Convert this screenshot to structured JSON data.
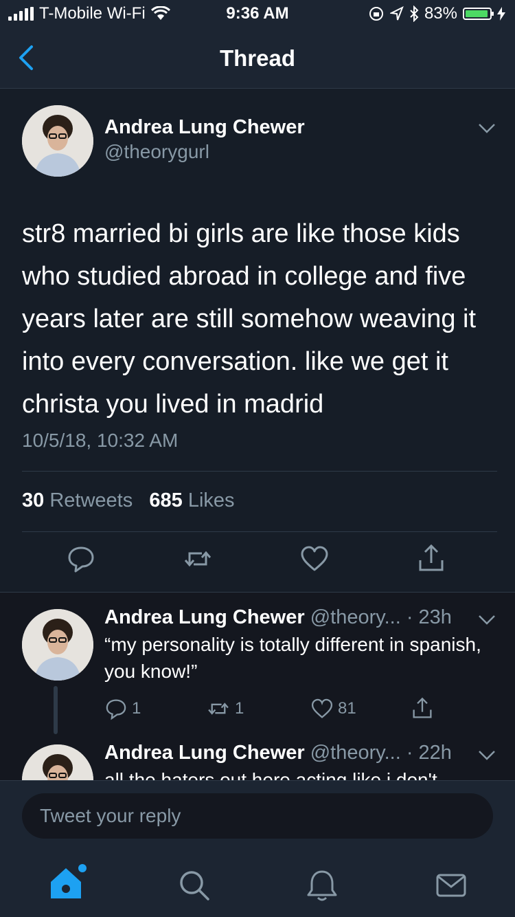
{
  "status_bar": {
    "carrier": "T-Mobile Wi-Fi",
    "time": "9:36 AM",
    "battery": "83%",
    "battery_level": 0.83
  },
  "nav": {
    "title": "Thread",
    "back_icon": "chevron-left-icon"
  },
  "tweet": {
    "author_name": "Andrea Lung Chewer",
    "author_handle": "@theorygurl",
    "text": "str8 married bi girls are like those kids who studied abroad in college and five years later are still somehow weaving it into every conversation. like we get it christa you lived in madrid",
    "timestamp": "10/5/18, 10:32 AM",
    "retweets_count": "30",
    "retweets_label": "Retweets",
    "likes_count": "685",
    "likes_label": "Likes"
  },
  "replies": [
    {
      "author_name": "Andrea Lung Chewer",
      "handle_time": "@theory... · 23h",
      "text": "“my personality is totally different in spanish, you know!”",
      "reply_count": "1",
      "retweet_count": "1",
      "like_count": "81"
    },
    {
      "author_name": "Andrea Lung Chewer",
      "handle_time": "@theory... · 22h",
      "text": "all the haters out here acting like i don't"
    }
  ],
  "reply_box": {
    "placeholder": "Tweet your reply"
  },
  "colors": {
    "accent": "#1da1f2",
    "background": "#14171f",
    "secondary_text": "#8899a6"
  }
}
